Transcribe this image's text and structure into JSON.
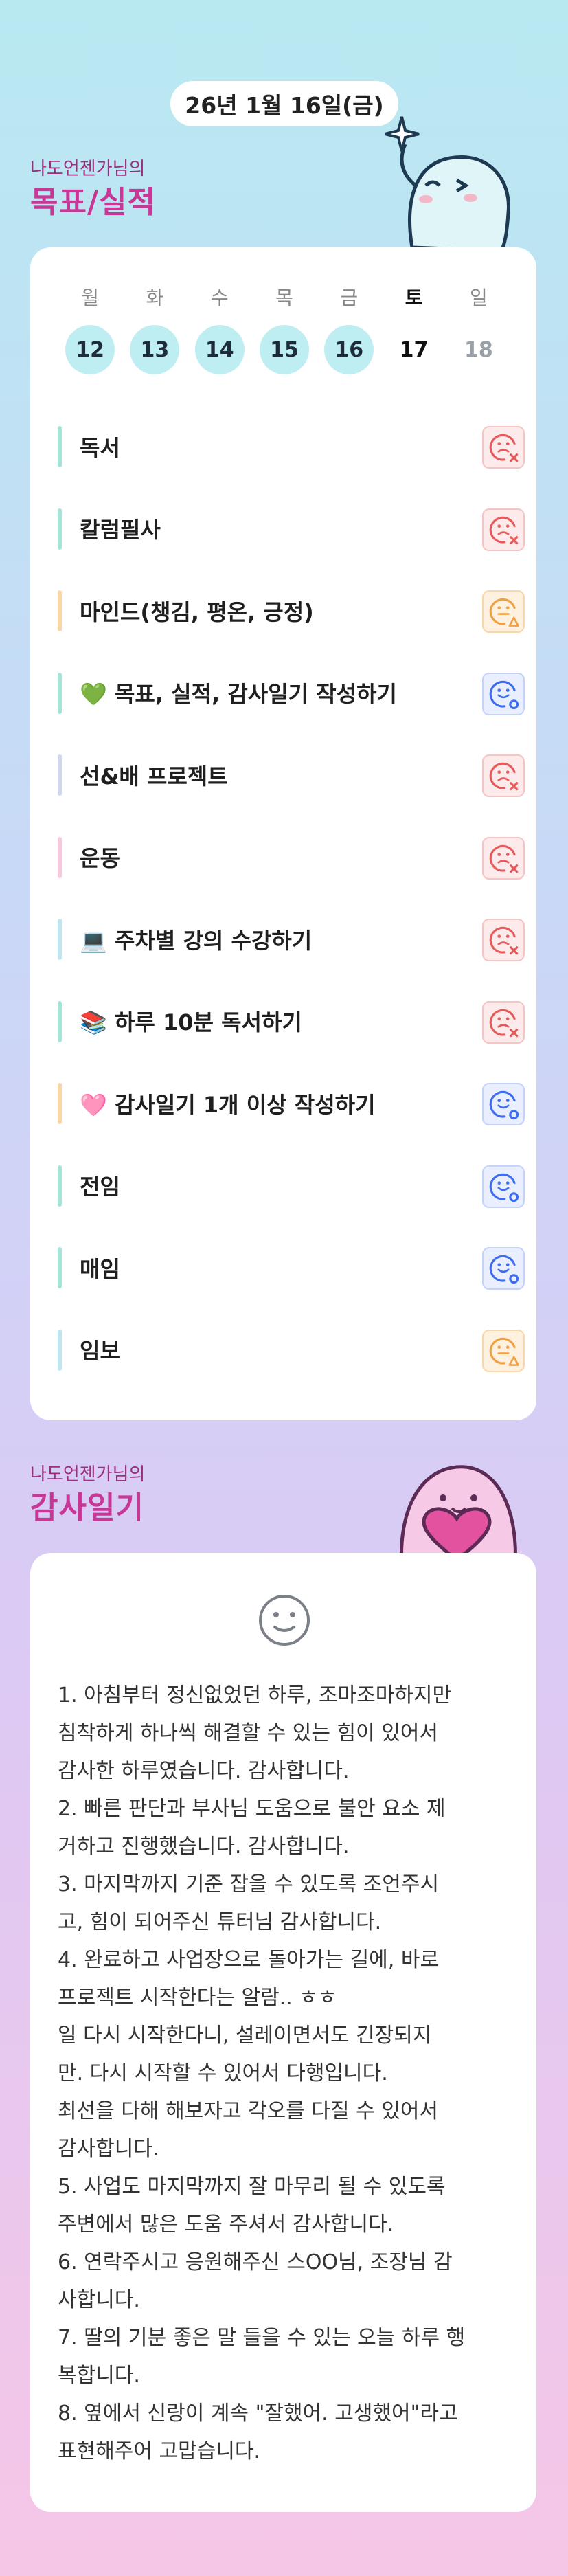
{
  "header": {
    "date": "26년 1월 16일(금)"
  },
  "goals_section": {
    "subtitle": "나도언젠가님의",
    "title": "목표/실적",
    "weekdays": [
      "월",
      "화",
      "수",
      "목",
      "금",
      "토",
      "일"
    ],
    "dates": [
      {
        "day": "12",
        "state": "done"
      },
      {
        "day": "13",
        "state": "done"
      },
      {
        "day": "14",
        "state": "done"
      },
      {
        "day": "15",
        "state": "done"
      },
      {
        "day": "16",
        "state": "done"
      },
      {
        "day": "17",
        "state": "today"
      },
      {
        "day": "18",
        "state": "future"
      }
    ],
    "items": [
      {
        "label": "독서",
        "status": "fail",
        "bar_color": "#a7e3d6"
      },
      {
        "label": "칼럼필사",
        "status": "fail",
        "bar_color": "#a7e3d6"
      },
      {
        "label": "마인드(챙김, 평온, 긍정)",
        "status": "partial",
        "bar_color": "#f8d6a8"
      },
      {
        "label": "💚 목표, 실적, 감사일기 작성하기",
        "status": "success",
        "bar_color": "#a7e3d6"
      },
      {
        "label": "선&배 프로젝트",
        "status": "fail",
        "bar_color": "#cfd6ee"
      },
      {
        "label": "운동",
        "status": "fail",
        "bar_color": "#f7c8dc"
      },
      {
        "label": "💻 주차별 강의 수강하기",
        "status": "fail",
        "bar_color": "#bfe6f0"
      },
      {
        "label": "📚 하루 10분 독서하기",
        "status": "fail",
        "bar_color": "#a7e3d6"
      },
      {
        "label": "🩷 감사일기 1개 이상 작성하기",
        "status": "success",
        "bar_color": "#f8d6a8"
      },
      {
        "label": "전임",
        "status": "success",
        "bar_color": "#a7e3d6"
      },
      {
        "label": "매임",
        "status": "success",
        "bar_color": "#a7e3d6"
      },
      {
        "label": "임보",
        "status": "partial",
        "bar_color": "#bfe6f0"
      }
    ]
  },
  "gratitude_section": {
    "subtitle": "나도언젠가님의",
    "title": "감사일기",
    "mood_icon": "smile-icon",
    "text": "1. 아침부터 정신없었던 하루, 조마조마하지만\n침착하게 하나씩 해결할 수 있는 힘이 있어서\n감사한 하루였습니다. 감사합니다.\n2. 빠른 판단과 부사님 도움으로 불안 요소 제\n거하고 진행했습니다. 감사합니다.\n3. 마지막까지 기준 잡을 수 있도록 조언주시\n고, 힘이 되어주신 튜터님 감사합니다.\n4. 완료하고 사업장으로 돌아가는 길에, 바로\n프로젝트 시작한다는 알람.. ㅎㅎ\n일 다시 시작한다니, 설레이면서도 긴장되지\n만. 다시 시작할 수 있어서 다행입니다.\n최선을 다해 해보자고 각오를 다질 수 있어서\n감사합니다.\n5. 사업도 마지막까지 잘 마무리 될 수 있도록\n주변에서 많은 도움 주셔서 감사합니다.\n6. 연락주시고 응원해주신 스OO님, 조장님 감\n사합니다.\n7. 딸의 기분 좋은 말 들을 수 있는 오늘 하루 행\n복합니다.\n8. 옆에서 신랑이 계속 \"잘했어. 고생했어\"라고\n표현해주어 고맙습니다."
  },
  "colors": {
    "accent": "#c93796",
    "fail": "#e85a5a",
    "partial": "#f0a040",
    "success": "#3d6cf0",
    "done_day": "#bfeef2"
  }
}
